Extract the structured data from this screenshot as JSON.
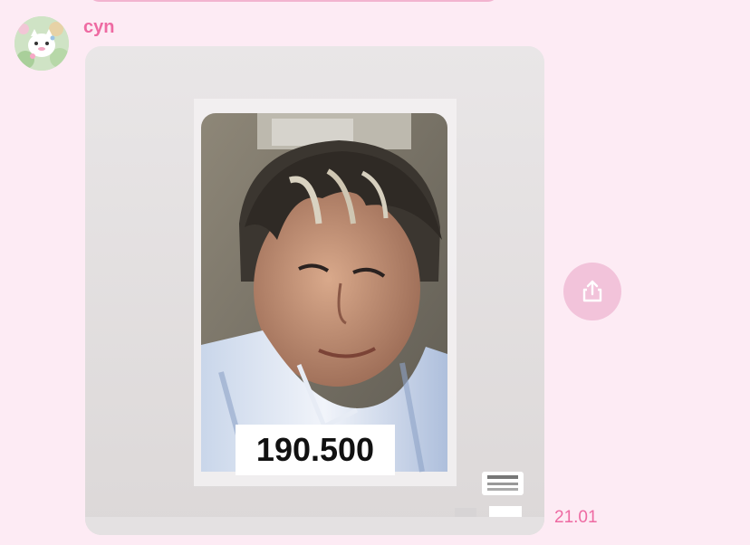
{
  "chat": {
    "sender_name": "cyn",
    "photo_message": {
      "price_tag": "190.500",
      "timestamp": "21.01"
    }
  },
  "icons": {
    "share": "share-icon"
  },
  "colors": {
    "background": "#fdebf4",
    "accent_pink": "#ee6aa2",
    "share_button": "#f2c3da"
  }
}
